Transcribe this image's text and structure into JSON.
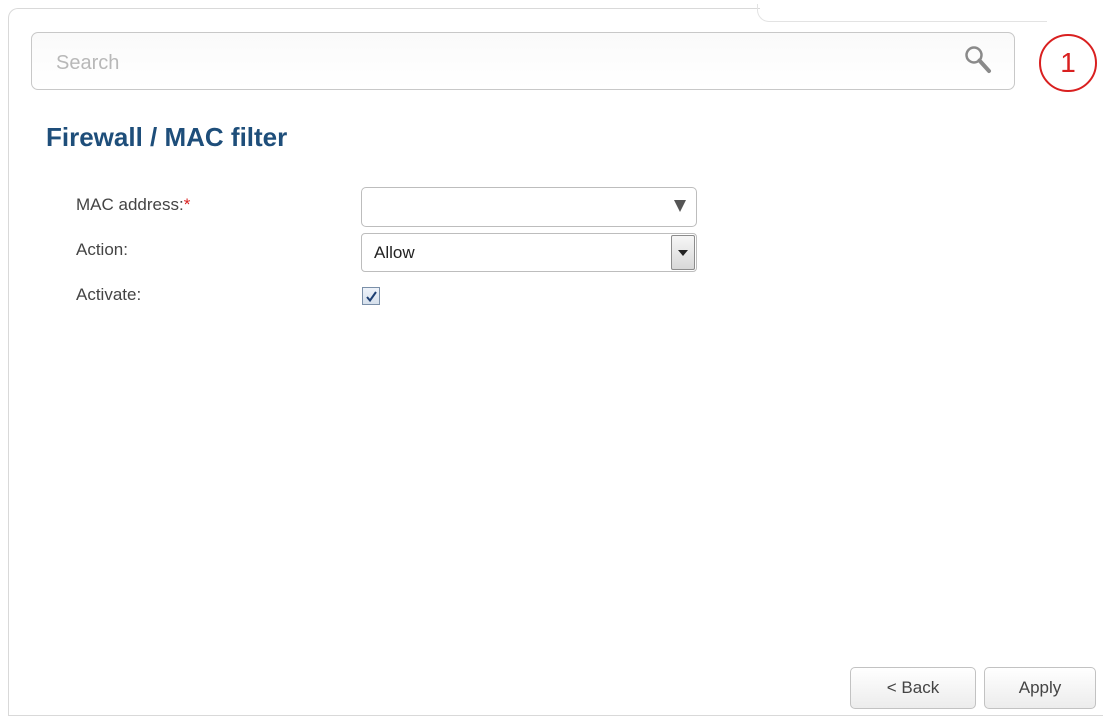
{
  "search": {
    "placeholder": "Search"
  },
  "notifications": {
    "count": "1"
  },
  "page": {
    "title": "Firewall /  MAC filter"
  },
  "form": {
    "mac_address": {
      "label": "MAC address:",
      "required_mark": "*",
      "value": ""
    },
    "action": {
      "label": "Action:",
      "value": "Allow"
    },
    "activate": {
      "label": "Activate:",
      "checked": true
    }
  },
  "buttons": {
    "back": "< Back",
    "apply": "Apply"
  },
  "colors": {
    "title": "#1e4e7a",
    "required": "#d92020",
    "badge": "#d92020"
  },
  "icons": {
    "search": "search-icon",
    "dropdown": "triangle-down-icon",
    "check": "checkmark-icon"
  }
}
